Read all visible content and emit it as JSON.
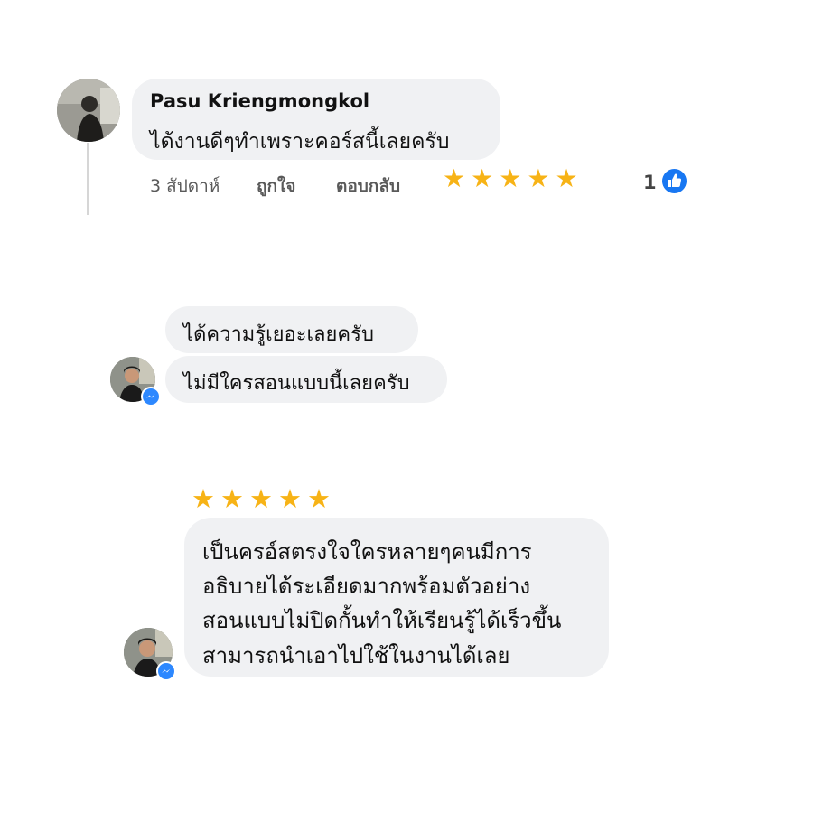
{
  "fb_comment": {
    "author": "Pasu Kriengmongkol",
    "text": "ได้งานดีๆทำเพราะคอร์สนี้เลยครับ",
    "time": "3 สัปดาห์",
    "like_label": "ถูกใจ",
    "reply_label": "ตอบกลับ",
    "rating": 5,
    "reaction_count": "1",
    "reaction_icon": "thumbs-up-icon",
    "star_color": "#f7b316",
    "reaction_color": "#1877f2"
  },
  "messenger_chat": {
    "messages": [
      "ได้ความรู้เยอะเลยครับ",
      "ไม่มีใครสอนแบบนี้เลยครับ"
    ],
    "badge_icon": "messenger-icon",
    "badge_color": "#2d88ff"
  },
  "review": {
    "rating": 5,
    "lines": [
      "เป็นครอ์สตรงใจใครหลายๆคนมีการ",
      "อธิบายได้ระเอียดมากพร้อมตัวอย่าง",
      "สอนแบบไม่ปิดกั้นทำให้เรียนรู้ได้เร็วขึ้น",
      "สามารถนำเอาไปใช้ในงานได้เลย"
    ],
    "badge_icon": "messenger-icon"
  }
}
